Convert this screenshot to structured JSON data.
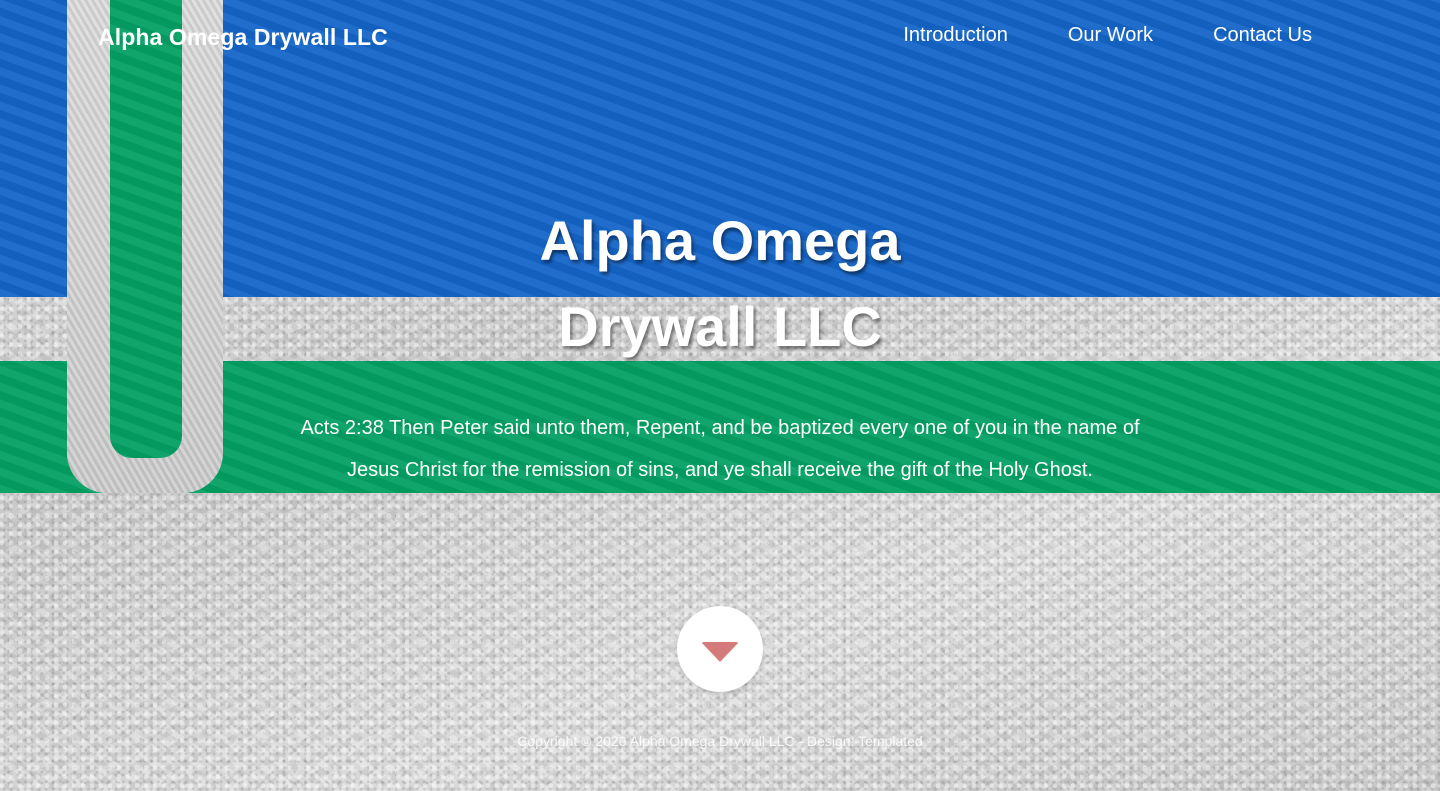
{
  "nav": {
    "brand": "Alpha Omega Drywall LLC",
    "links": [
      {
        "label": "Introduction"
      },
      {
        "label": "Our Work"
      },
      {
        "label": "Contact Us"
      }
    ]
  },
  "hero": {
    "title_line1": "Alpha Omega",
    "title_line2": "Drywall LLC",
    "verse_line1": "Acts 2:38 Then Peter said unto them, Repent, and be baptized every one of you in the name of",
    "verse_line2": "Jesus Christ for the remission of sins, and ye shall receive the gift of the Holy Ghost.",
    "scroll_icon": "caret-down-icon"
  },
  "footer": {
    "text": "Copyright © 2020 Alpha Omega Drywall LLC - Design: Templated"
  },
  "colors": {
    "band_blue": "#1565c9",
    "band_green": "#049f63",
    "scroll_arrow": "#d47a7a",
    "text": "#ffffff"
  }
}
